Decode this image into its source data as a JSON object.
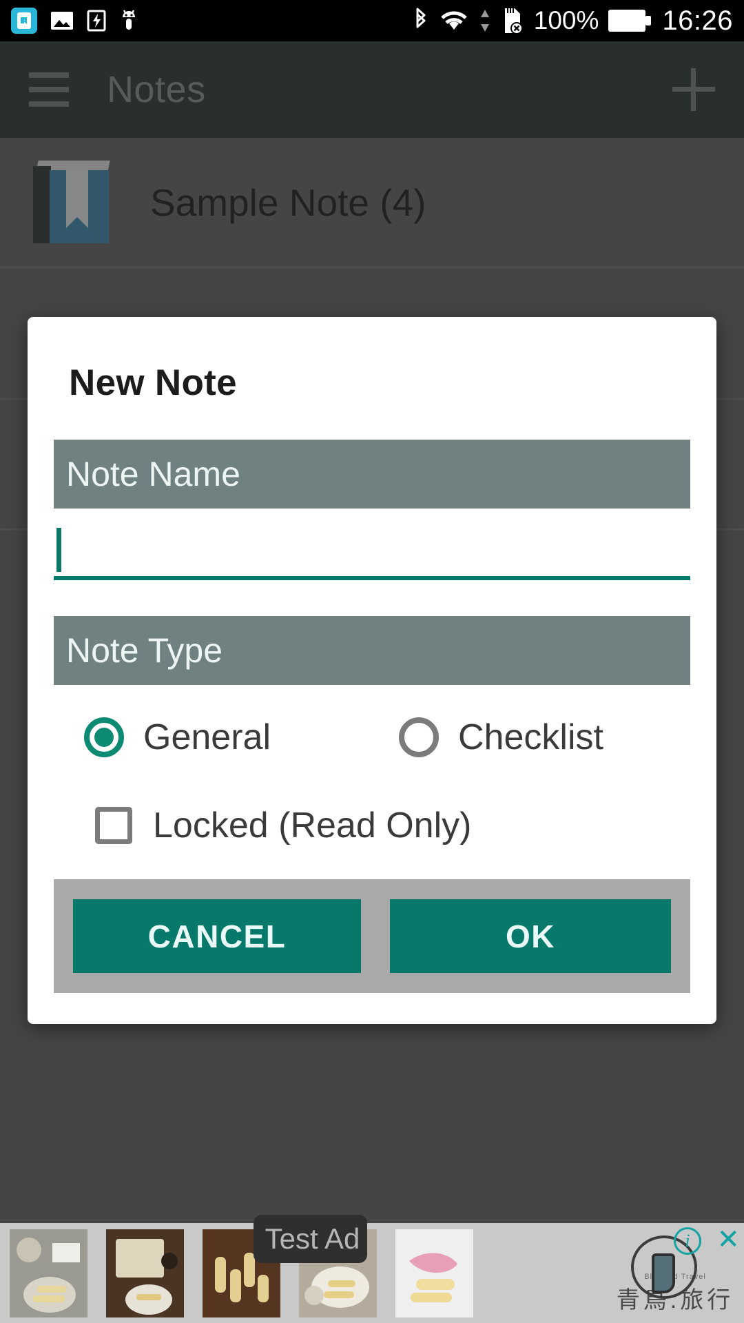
{
  "statusbar": {
    "icons": [
      "screen-cast-icon",
      "image-icon",
      "battery-charging-icon",
      "android-debug-icon"
    ],
    "right_icons": [
      "bluetooth-icon",
      "wifi-icon",
      "data-arrows-icon",
      "sdcard-removed-icon"
    ],
    "battery_percent": "100%",
    "time": "16:26"
  },
  "appbar": {
    "menu_icon": "hamburger-menu-icon",
    "title": "Notes",
    "add_icon": "plus-icon"
  },
  "notes_list": {
    "items": [
      {
        "label": "Sample Note (4)",
        "icon": "book-icon"
      }
    ]
  },
  "dialog": {
    "title": "New Note",
    "name_section_label": "Note Name",
    "name_input_value": "",
    "name_input_placeholder": "",
    "type_section_label": "Note Type",
    "radio_options": [
      {
        "label": "General",
        "selected": true
      },
      {
        "label": "Checklist",
        "selected": false
      }
    ],
    "checkbox": {
      "label": "Locked (Read Only)",
      "checked": false
    },
    "cancel_label": "CANCEL",
    "ok_label": "OK"
  },
  "ad": {
    "badge": "Test Ad",
    "logo_cn": "青鳥.旅行",
    "logo_en": "BlueBird Travel",
    "close_icon": "close-icon",
    "info_icon": "info-icon"
  },
  "colors": {
    "accent_teal": "#00796b",
    "section_bar": "#6f8180",
    "appbar": "#2b3635",
    "scrim": "#5d5d5d",
    "button_bar": "#a9a9a9"
  }
}
